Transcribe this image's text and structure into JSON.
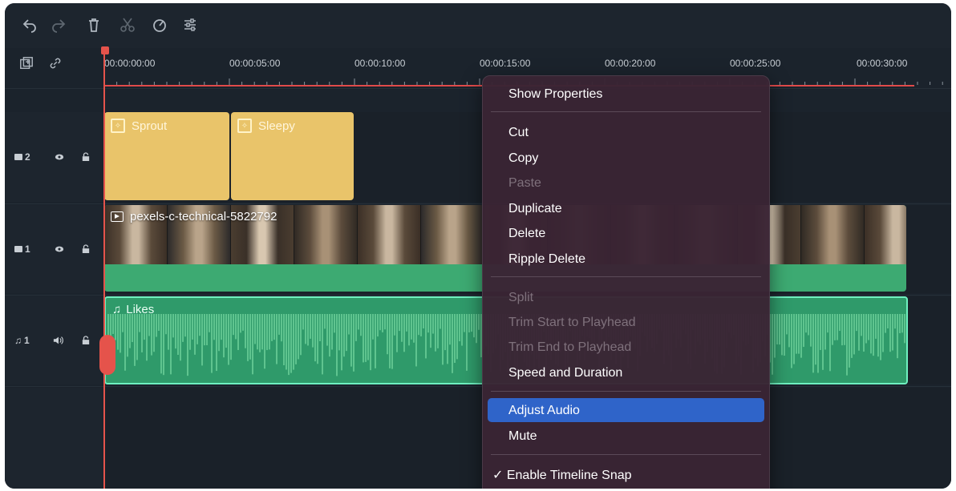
{
  "toolbar": {
    "icons": [
      "undo-icon",
      "redo-icon",
      "trash-icon",
      "scissors-icon",
      "speed-icon",
      "adjust-icon"
    ]
  },
  "ruler": {
    "ticks": [
      "00:00:00:00",
      "00:00:05:00",
      "00:00:10:00",
      "00:00:15:00",
      "00:00:20:00",
      "00:00:25:00",
      "00:00:30:00"
    ]
  },
  "tracks": {
    "sticker": {
      "number": "2"
    },
    "video": {
      "number": "1"
    },
    "audio": {
      "number": "1"
    }
  },
  "clips": {
    "sticker1": "Sprout",
    "sticker2": "Sleepy",
    "video": "pexels-c-technical-5822792",
    "audio": "Likes"
  },
  "menu": {
    "show_properties": "Show Properties",
    "cut": "Cut",
    "copy": "Copy",
    "paste": "Paste",
    "duplicate": "Duplicate",
    "delete": "Delete",
    "ripple_delete": "Ripple Delete",
    "split": "Split",
    "trim_start": "Trim Start to Playhead",
    "trim_end": "Trim End to Playhead",
    "speed_duration": "Speed and Duration",
    "adjust_audio": "Adjust Audio",
    "mute": "Mute",
    "enable_snap": "✓ Enable Timeline Snap"
  },
  "colors": {
    "accent_highlight": "#2f64c9",
    "playhead": "#e5534b",
    "sticker_clip": "#e9c46a",
    "video_clip": "#3daa72",
    "audio_clip": "#2f9a6a"
  }
}
